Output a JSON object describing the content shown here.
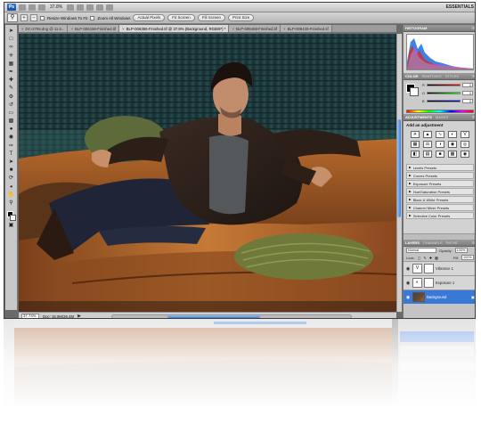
{
  "appbar": {
    "logo": "Ps",
    "zoom": "37.8%",
    "workspace": "ESSENTIALS"
  },
  "options_bar": {
    "tool_icon": "zoom-icon",
    "resize_windows_label": "Resize Windows To Fit",
    "zoom_all_windows_label": "Zoom All Windows",
    "actual_pixels_label": "Actual Pixels",
    "fit_screen_label": "Fit Screen",
    "fill_screen_label": "Fill Screen",
    "print_size_label": "Print Size"
  },
  "tabs": [
    {
      "label": "DC-2706.dng @ 11.5..."
    },
    {
      "label": "BLP-006156-Finished.tif"
    },
    {
      "label": "BLP-006355-Finished.tif @ 37.8% (Background, RGB/8*) *"
    },
    {
      "label": "BLP-006468-Finished.tif"
    },
    {
      "label": "BLP-006435-Finished.tif"
    }
  ],
  "status": {
    "zoom": "37.74%",
    "doc": "Doc: 15.9M/26.4M"
  },
  "histogram_panel": {
    "tab_histogram": "HISTOGRAM"
  },
  "color_panel": {
    "tab_color": "COLOR",
    "tab_swatches": "SWATCHES",
    "tab_styles": "STYLES",
    "channels": [
      {
        "label": "R",
        "value": "0"
      },
      {
        "label": "G",
        "value": "0"
      },
      {
        "label": "B",
        "value": "0"
      }
    ]
  },
  "adjustments_panel": {
    "tab_adjustments": "ADJUSTMENTS",
    "tab_masks": "MASKS",
    "title": "Add an adjustment",
    "presets": [
      "Levels Presets",
      "Curves Presets",
      "Exposure Presets",
      "Hue/Saturation Presets",
      "Black & White Presets",
      "Channel Mixer Presets",
      "Selective Color Presets"
    ]
  },
  "layers_panel": {
    "tab_layers": "LAYERS",
    "tab_channels": "CHANNELS",
    "tab_paths": "PATHS",
    "blend_mode": "Normal",
    "opacity_label": "Opacity:",
    "opacity_value": "100%",
    "lock_label": "Lock:",
    "fill_label": "Fill:",
    "fill_value": "100%",
    "layers": [
      {
        "name": "Vibrance 1",
        "icon": "vibrance-icon"
      },
      {
        "name": "Exposure 1",
        "icon": "exposure-icon"
      },
      {
        "name": "Background",
        "icon": "lock-icon"
      }
    ]
  },
  "colors": {
    "selection_blue": "#3a78d8",
    "scroll_blue": "#3f7fd6",
    "chrome_gray": "#6a6a6a"
  }
}
